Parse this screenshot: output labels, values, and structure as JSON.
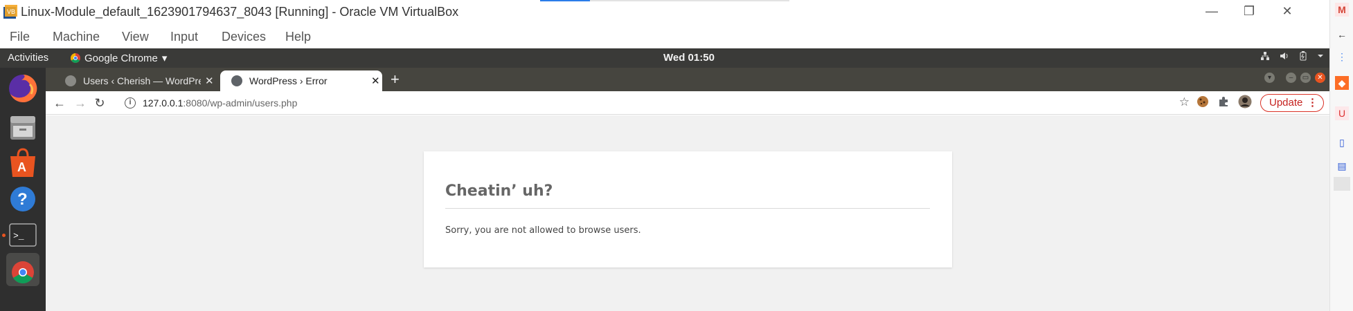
{
  "vbox": {
    "title": "Linux-Module_default_1623901794637_8043 [Running] - Oracle VM VirtualBox",
    "menu": [
      "File",
      "Machine",
      "View",
      "Input",
      "Devices",
      "Help"
    ],
    "controls": {
      "minimize": "—",
      "restore": "❐",
      "close": "✕"
    }
  },
  "ubuntu": {
    "activities": "Activities",
    "app_name": "Google Chrome",
    "app_arrow": "▾",
    "clock": "Wed 01:50"
  },
  "chrome": {
    "tabs": [
      {
        "title": "Users ‹ Cherish — WordPress",
        "close": "✕"
      },
      {
        "title": "WordPress › Error",
        "close": "✕"
      }
    ],
    "new_tab": "+",
    "url_host": "127.0.0.1",
    "url_path": ":8080/wp-admin/users.php",
    "update_label": "Update",
    "update_menu": "⋮"
  },
  "page": {
    "error_title": "Cheatin’ uh?",
    "error_message": "Sorry, you are not allowed to browse users."
  },
  "colors": {
    "ubuntu_panel": "#3a3a38",
    "chrome_tabbar": "#46453f",
    "update_red": "#d93025",
    "page_bg": "#f1f1f1"
  }
}
